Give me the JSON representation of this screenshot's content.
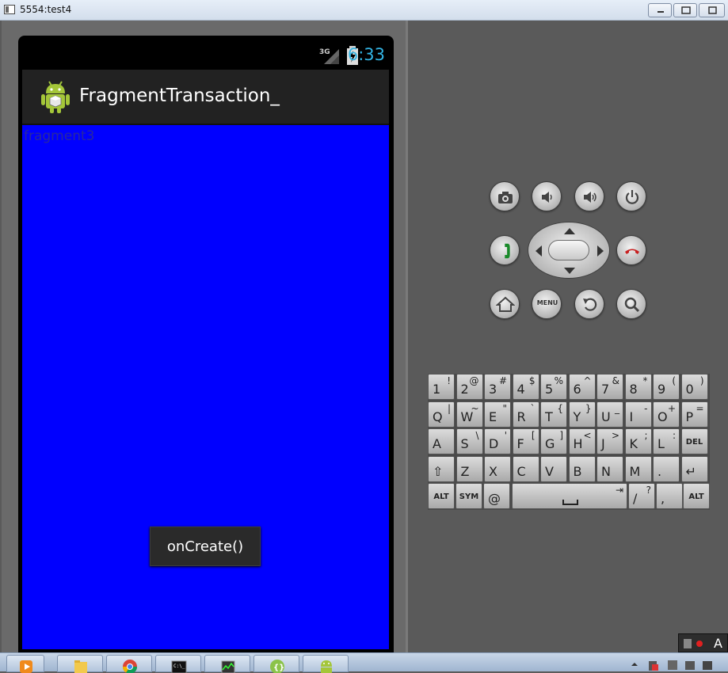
{
  "window": {
    "title": "5554:test4",
    "minimize_icon": "minimize-icon",
    "maximize_icon": "maximize-icon",
    "close_icon": "close-icon"
  },
  "device": {
    "status_bar": {
      "network": "3G",
      "time": "6:33"
    },
    "action_bar": {
      "title": "FragmentTransaction_"
    },
    "content": {
      "fragment_label": "fragment3",
      "background_color": "#0000ff"
    },
    "toast": {
      "text": "onCreate()"
    }
  },
  "hardware_buttons": {
    "row1": [
      "camera-icon",
      "volume-down-icon",
      "volume-up-icon",
      "power-icon"
    ],
    "row2": [
      "call-icon",
      "dpad",
      "end-call-icon"
    ],
    "row3": [
      "home-icon",
      "menu-button",
      "back-icon",
      "search-icon"
    ],
    "menu_label": "MENU"
  },
  "keyboard": {
    "row1": [
      {
        "main": "1",
        "sub": "!"
      },
      {
        "main": "2",
        "sub": "@"
      },
      {
        "main": "3",
        "sub": "#"
      },
      {
        "main": "4",
        "sub": "$"
      },
      {
        "main": "5",
        "sub": "%"
      },
      {
        "main": "6",
        "sub": "^"
      },
      {
        "main": "7",
        "sub": "&"
      },
      {
        "main": "8",
        "sub": "*"
      },
      {
        "main": "9",
        "sub": "("
      },
      {
        "main": "0",
        "sub": ")"
      }
    ],
    "row2": [
      {
        "main": "Q",
        "sub": "|"
      },
      {
        "main": "W",
        "sub": "~"
      },
      {
        "main": "E",
        "sub": "\""
      },
      {
        "main": "R",
        "sub": "`"
      },
      {
        "main": "T",
        "sub": "{"
      },
      {
        "main": "Y",
        "sub": "}"
      },
      {
        "main": "U",
        "sub": "_"
      },
      {
        "main": "I",
        "sub": "-"
      },
      {
        "main": "O",
        "sub": "+"
      },
      {
        "main": "P",
        "sub": "="
      }
    ],
    "row3": [
      {
        "main": "A",
        "sub": ""
      },
      {
        "main": "S",
        "sub": "\\"
      },
      {
        "main": "D",
        "sub": "'"
      },
      {
        "main": "F",
        "sub": "["
      },
      {
        "main": "G",
        "sub": "]"
      },
      {
        "main": "H",
        "sub": "<"
      },
      {
        "main": "J",
        "sub": ">"
      },
      {
        "main": "K",
        "sub": ";"
      },
      {
        "main": "L",
        "sub": ":"
      },
      {
        "main": "DEL",
        "sub": ""
      }
    ],
    "row4": [
      {
        "main": "⇧",
        "sub": ""
      },
      {
        "main": "Z",
        "sub": ""
      },
      {
        "main": "X",
        "sub": ""
      },
      {
        "main": "C",
        "sub": ""
      },
      {
        "main": "V",
        "sub": ""
      },
      {
        "main": "B",
        "sub": ""
      },
      {
        "main": "N",
        "sub": ""
      },
      {
        "main": "M",
        "sub": ""
      },
      {
        "main": ".",
        "sub": ""
      },
      {
        "main": "↵",
        "sub": ""
      }
    ],
    "row5": {
      "alt_left": "ALT",
      "sym": "SYM",
      "at": "@",
      "space_tab": "⇥",
      "slash": "/",
      "question": "?",
      "comma": ",",
      "alt_right": "ALT"
    }
  },
  "taskbar": {
    "items": [
      "media-player-icon",
      "file-explorer-icon",
      "chrome-icon",
      "command-prompt-icon",
      "task-manager-icon",
      "app-icon",
      "android-icon"
    ],
    "tray_text": "A"
  }
}
